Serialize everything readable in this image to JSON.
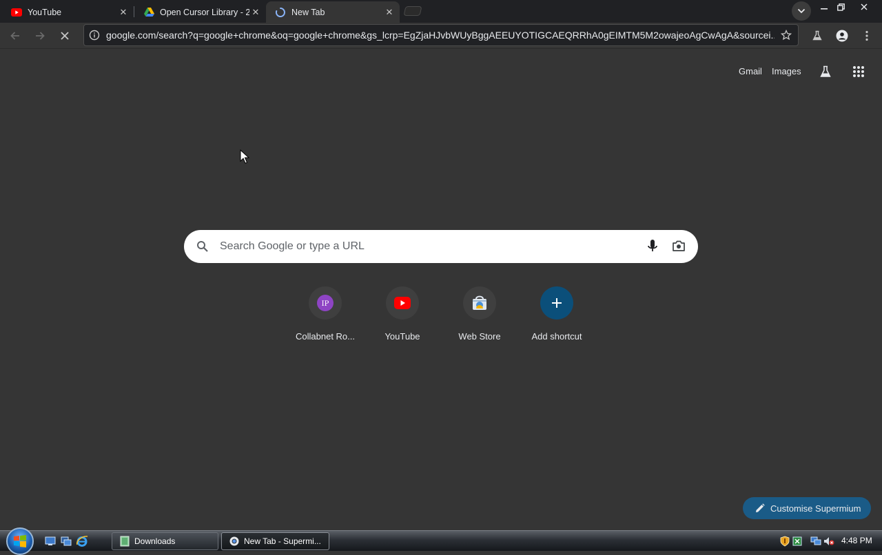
{
  "tabs": [
    {
      "title": "YouTube",
      "favicon": "youtube-icon"
    },
    {
      "title": "Open Cursor Library - 2",
      "favicon": "google-drive-icon"
    },
    {
      "title": "New Tab",
      "favicon": "loading-spinner-icon"
    }
  ],
  "toolbar": {
    "url": "google.com/search?q=google+chrome&oq=google+chrome&gs_lcrp=EgZjaHJvbWUyBggAEEUYOTIGCAEQRRhA0gEIMTM5M2owajeoAgCwAgA&sourcei..."
  },
  "page": {
    "top_links": {
      "gmail": "Gmail",
      "images": "Images"
    },
    "search": {
      "placeholder": "Search Google or type a URL"
    },
    "shortcuts": [
      {
        "label": "Collabnet Ro...",
        "icon": "ip-monogram-icon",
        "monogram": "IP"
      },
      {
        "label": "YouTube",
        "icon": "youtube-icon"
      },
      {
        "label": "Web Store",
        "icon": "web-store-icon"
      },
      {
        "label": "Add shortcut",
        "icon": "plus-icon"
      }
    ],
    "customise_label": "Customise Supermium"
  },
  "taskbar": {
    "items": [
      {
        "label": "Downloads",
        "icon": "folder-icon"
      },
      {
        "label": "New Tab - Supermi...",
        "icon": "chrome-icon"
      }
    ],
    "clock": "4:48 PM"
  },
  "colors": {
    "page_bg": "#353535",
    "tabstrip_bg": "#202124",
    "youtube_red": "#ff0000",
    "ip_monogram": "#8e44c4",
    "add_shortcut_blue": "#0b4f7a",
    "customise_bg": "#1a5b87"
  }
}
